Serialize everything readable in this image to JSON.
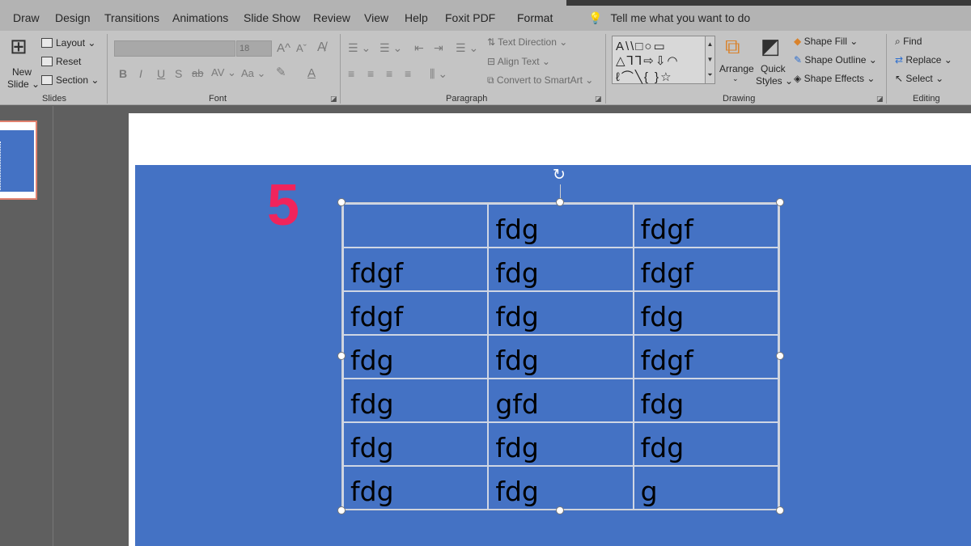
{
  "ribbon_tabs": [
    "Draw",
    "Design",
    "Transitions",
    "Animations",
    "Slide Show",
    "Review",
    "View",
    "Help",
    "Foxit PDF",
    "Format"
  ],
  "tell_me": "Tell me what you want to do",
  "slides_group": {
    "label": "Slides",
    "new_slide_line1": "New",
    "new_slide_line2": "Slide ⌄",
    "layout": "Layout ⌄",
    "reset": "Reset",
    "section": "Section ⌄"
  },
  "font_group": {
    "label": "Font",
    "font_size": "18",
    "bold": "B",
    "italic": "I",
    "underline": "U",
    "shadow": "S",
    "strike": "ab",
    "spacing": "AV ⌄",
    "case": "Aa ⌄",
    "grow": "A^",
    "shrink": "Aˇ"
  },
  "paragraph_group": {
    "label": "Paragraph",
    "text_direction": "Text Direction ⌄",
    "align_text": "Align Text ⌄",
    "convert_smartart": "Convert to SmartArt ⌄"
  },
  "drawing_group": {
    "label": "Drawing",
    "arrange": "Arrange",
    "quick_styles_line1": "Quick",
    "quick_styles_line2": "Styles ⌄",
    "shape_fill": "Shape Fill ⌄",
    "shape_outline": "Shape Outline ⌄",
    "shape_effects": "Shape Effects ⌄",
    "shapes_row1": "A\\\\□○▭",
    "shapes_row2": "△⅂⅂⇨⇩◠",
    "shapes_row3": "ℓ⌒╲{ }☆"
  },
  "editing_group": {
    "label": "Editing",
    "find": "Find",
    "replace": "Replace ⌄",
    "select": "Select ⌄"
  },
  "slide": {
    "number": "5",
    "table": [
      [
        "",
        "fdg",
        "fdgf"
      ],
      [
        "fdgf",
        "fdg",
        "fdgf"
      ],
      [
        "fdgf",
        "fdg",
        "fdg"
      ],
      [
        "fdg",
        "fdg",
        "fdgf"
      ],
      [
        "fdg",
        "gfd",
        "fdg"
      ],
      [
        "fdg",
        "fdg",
        "fdg"
      ],
      [
        "fdg",
        "fdg",
        "g"
      ]
    ]
  },
  "colors": {
    "slide_blue": "#4472c4",
    "number_pink": "#f0245c",
    "ribbon_bg": "#c4c4c4"
  }
}
